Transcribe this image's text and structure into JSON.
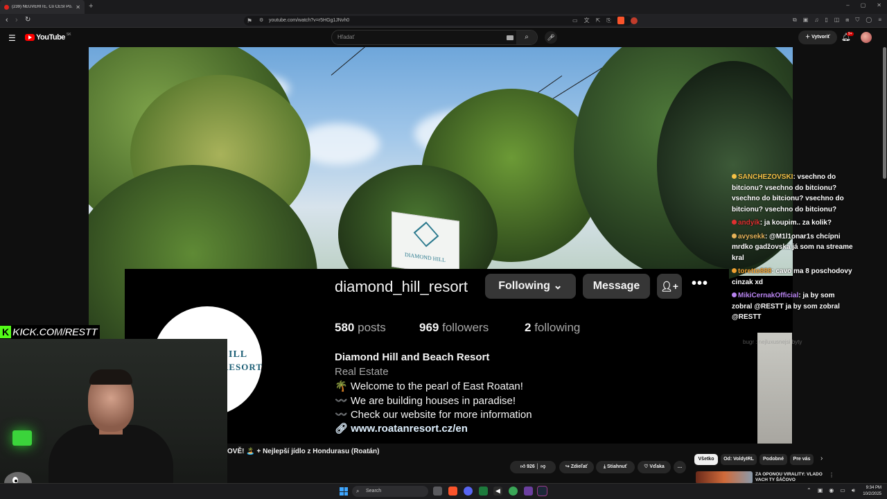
{
  "browser": {
    "tab_title": "(239) NEUVĚŘÍTE, Co ČEŠI Po...",
    "new_tab_icon": "+",
    "url": "youtube.com/watch?v=r5HGg1JNvh0",
    "extension_badge": "1"
  },
  "youtube": {
    "logo_text": "YouTube",
    "region": "SK",
    "search_placeholder": "Hľadať",
    "create_label": "Vytvoriť",
    "notif_badge": "9+"
  },
  "instagram": {
    "username": "diamond_hill_resort",
    "following_label": "Following",
    "message_label": "Message",
    "posts_count": "580",
    "posts_label": "posts",
    "followers_count": "969",
    "followers_label": "followers",
    "following_count": "2",
    "following_stat_label": "following",
    "display_name": "Diamond Hill and Beach Resort",
    "category": "Real Estate",
    "bio": [
      "🌴 Welcome to the pearl of East Roatan!",
      "〰️ We are building houses in paradise!",
      "〰️ Check our website for more information"
    ],
    "link": "www.roatanresort.cz/en",
    "avatar_text_1": "ILL",
    "avatar_text_2": "RESORT",
    "sign_text": "DIAMOND HILL"
  },
  "chat": [
    {
      "user": "SANCHEZOVSKI",
      "color": "#f5c146",
      "text": ": vsechno do bitcionu? vsechno do bitcionu? vsechno do bitcionu? vsechno do bitcionu? vsechno do bitcionu?"
    },
    {
      "user": "andyik",
      "color": "#e03030",
      "text": ": ja koupim.. za kolik?"
    },
    {
      "user": "avysekk",
      "color": "#e6b35a",
      "text": ": @M1l1onar1s chcípni mrdko gadžovska já som na streame kral"
    },
    {
      "user": "toretto888",
      "color": "#f0a030",
      "text": ": cavo ma 8 poschodovy cinzak xd"
    },
    {
      "user": "MikiCernakOfficial",
      "color": "#b884f0",
      "text": ": ja by som zobral @RESTT ja by som zobral @RESTT"
    }
  ],
  "chat_faded": "bugr : nejluxusnejsi byty",
  "stream": {
    "kick_url": "KICK.COM/RESTT"
  },
  "video": {
    "title": "OVĚ! 🏝️ + Nejlepší jídlo z Hondurasu (Roatán)",
    "like_count": "926",
    "share_label": "Zdieľať",
    "download_label": "Stiahnuť",
    "thanks_label": "Vďaka",
    "more_label": "…"
  },
  "chips": [
    "Všetko",
    "Od: VoldyIRL",
    "Podobné",
    "Pre vás"
  ],
  "recommendation": {
    "title": "ZA OPONOU VIRALITY: VLADO VACH TY ŠÁČOVO"
  },
  "taskbar": {
    "search_placeholder": "Search",
    "time": "9:34 PM",
    "date": "10/2/2025"
  },
  "colors": {
    "youtube_red": "#ff0000",
    "kick_green": "#53fc18",
    "ig_button": "#363636"
  }
}
